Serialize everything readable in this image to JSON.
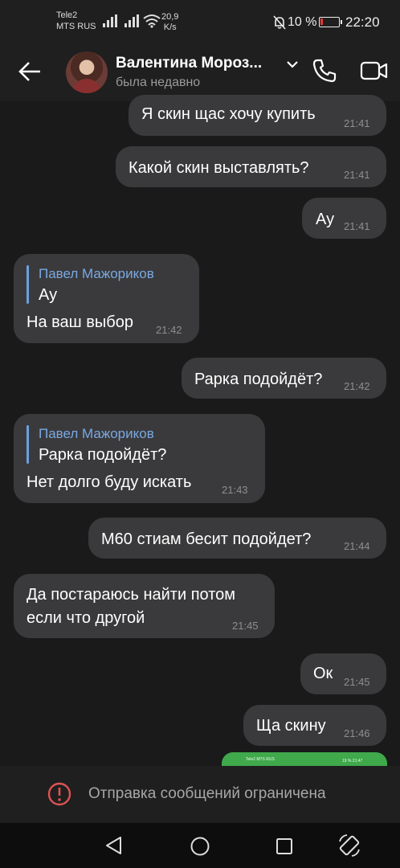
{
  "status_bar": {
    "carrier_1": "Tele2",
    "carrier_2": "MTS RUS",
    "net_speed_value": "20,9",
    "net_speed_unit": "K/s",
    "battery_percent": "10 %",
    "time": "22:20"
  },
  "header": {
    "contact_name": "Валентина Мороз...",
    "status": "была недавно"
  },
  "messages": [
    {
      "side": "out",
      "text": "Я скин щас хочу купить",
      "time": "21:41"
    },
    {
      "side": "out",
      "text": "Какой скин выставлять?",
      "time": "21:41"
    },
    {
      "side": "out",
      "text": "Ау",
      "time": "21:41"
    },
    {
      "side": "in",
      "reply_name": "Павел Мажориков",
      "reply_text": "Ау",
      "text": "На ваш выбор",
      "time": "21:42"
    },
    {
      "side": "out",
      "text": "Рарка подойдёт?",
      "time": "21:42"
    },
    {
      "side": "in",
      "reply_name": "Павел Мажориков",
      "reply_text": "Рарка подойдёт?",
      "text": "Нет долго буду искать",
      "time": "21:43"
    },
    {
      "side": "out",
      "text": "М60 стиам бесит подойдет?",
      "time": "21:44"
    },
    {
      "side": "in",
      "text_line1": "Да постараюсь найти потом",
      "text_line2": "если что другой",
      "time": "21:45"
    },
    {
      "side": "out",
      "text": "Ок",
      "time": "21:45"
    },
    {
      "side": "out",
      "text": "Ща скину",
      "time": "21:46"
    }
  ],
  "image_preview": {
    "mini_carrier": "Tele2 MTS RUS",
    "mini_status": "19 % 21:47"
  },
  "restriction": {
    "text": "Отправка сообщений ограничена"
  },
  "colors": {
    "background": "#1a1a1a",
    "bubble": "#3a3a3c",
    "reply_accent": "#7aa9e3",
    "warning": "#e05252",
    "preview_green": "#3fa94b"
  }
}
